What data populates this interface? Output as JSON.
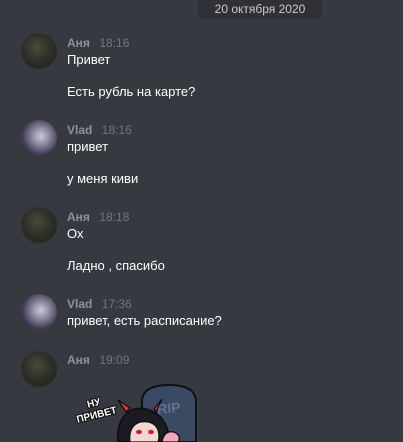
{
  "date_divider": "20 октября 2020",
  "messages": [
    {
      "author": "Аня",
      "time": "18:16",
      "lines": [
        "Привет",
        "Есть рубль на карте?"
      ]
    },
    {
      "author": "Vlad",
      "time": "18:16",
      "lines": [
        "привет",
        "у меня киви"
      ]
    },
    {
      "author": "Аня",
      "time": "18:18",
      "lines": [
        "Ох",
        "Ладно , спасибо"
      ]
    },
    {
      "author": "Vlad",
      "time": "17:36",
      "lines": [
        "привет, есть расписание?"
      ]
    },
    {
      "author": "Аня",
      "time": "19:09",
      "lines": []
    }
  ],
  "sticker": {
    "caption": "НУ ПРИВЕТ",
    "tombstone_text": "RIP"
  }
}
